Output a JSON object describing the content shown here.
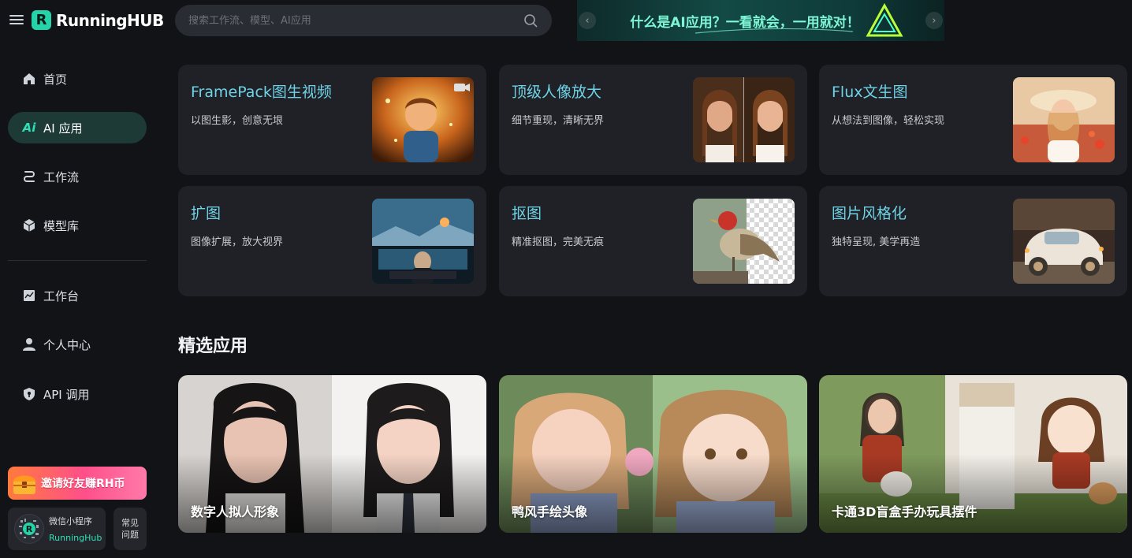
{
  "header": {
    "logo_mark": "R",
    "logo_text": "RunningHUB",
    "search_placeholder": "搜索工作流、模型、AI应用",
    "banner_text": "什么是AI应用？一看就会，一用就对！"
  },
  "sidebar": {
    "items": [
      {
        "label": "首页",
        "icon": "home-icon"
      },
      {
        "label": "AI 应用",
        "icon": "ai-icon",
        "active": true
      },
      {
        "label": "工作流",
        "icon": "workflow-icon"
      },
      {
        "label": "模型库",
        "icon": "cube-icon"
      },
      {
        "label": "工作台",
        "icon": "chart-icon"
      },
      {
        "label": "个人中心",
        "icon": "user-icon"
      },
      {
        "label": "API 调用",
        "icon": "shield-icon"
      }
    ],
    "invite_label": "邀请好友赚RH币",
    "mini_program": {
      "title": "微信小程序",
      "subtitle": "RunningHub"
    },
    "faq_label": "常见问题"
  },
  "tools": [
    {
      "title": "FramePack图生视频",
      "desc": "以图生影，创意无垠"
    },
    {
      "title": "顶级人像放大",
      "desc": "细节重现，清晰无界"
    },
    {
      "title": "Flux文生图",
      "desc": "从想法到图像，轻松实现"
    },
    {
      "title": "扩图",
      "desc": "图像扩展，放大视界"
    },
    {
      "title": "抠图",
      "desc": "精准抠图，完美无痕"
    },
    {
      "title": "图片风格化",
      "desc": "独特呈现, 美学再造"
    }
  ],
  "featured": {
    "title": "精选应用",
    "apps": [
      {
        "title": "数字人拟人形象"
      },
      {
        "title": "鸭风手绘头像"
      },
      {
        "title": "卡通3D盲盒手办玩具摆件"
      }
    ]
  },
  "colors": {
    "accent": "#2fe0b6",
    "background": "#121317",
    "card": "#1f2126",
    "tool_title": "#6fd3e7"
  }
}
